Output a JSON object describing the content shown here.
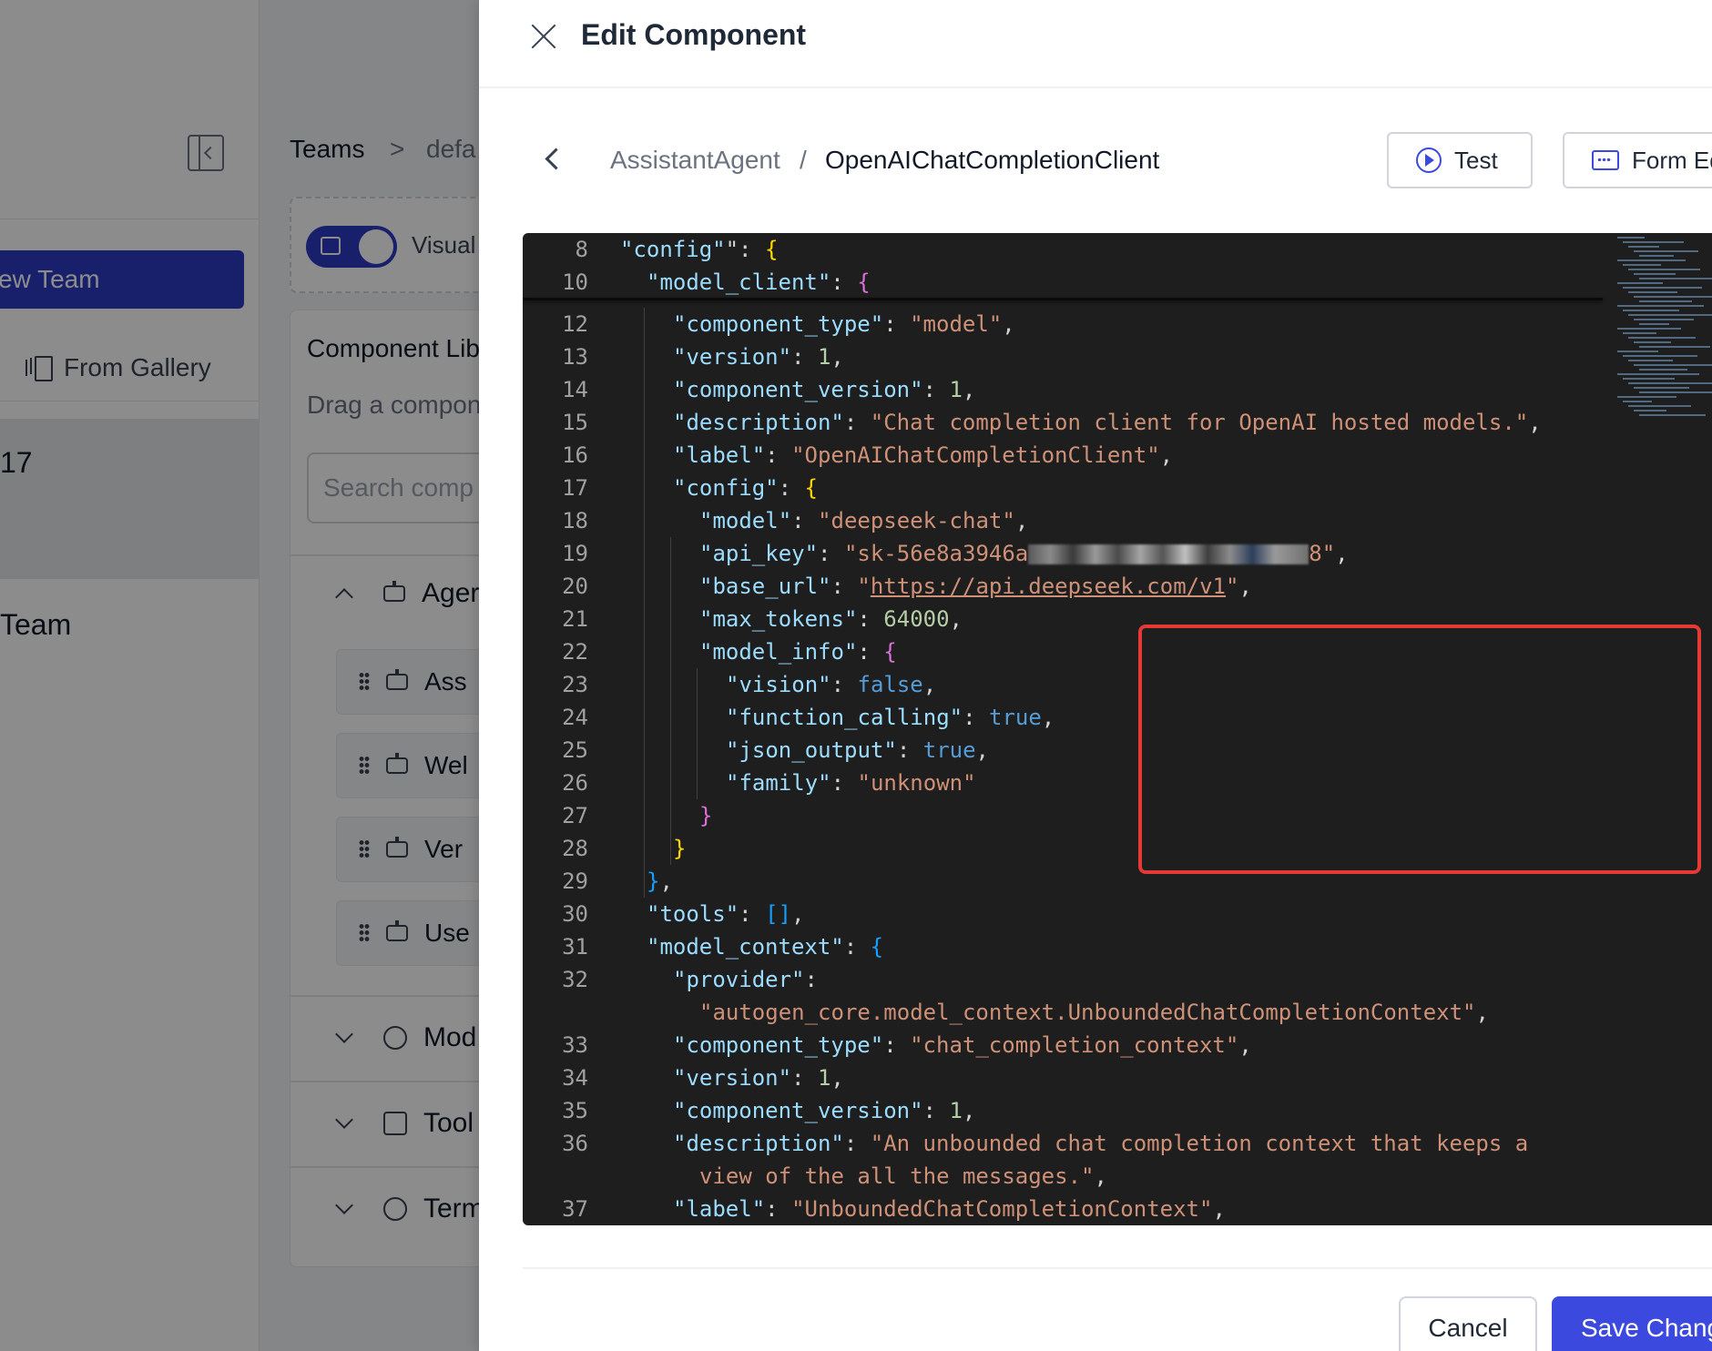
{
  "background": {
    "new_team_label": "ew Team",
    "from_gallery_label": "From Gallery",
    "team_card_number": "17",
    "team_name": "Team",
    "breadcrumb_teams": "Teams",
    "breadcrumb_sep": ">",
    "breadcrumb_current": "defa",
    "toggle_label": "Visual",
    "library": {
      "title": "Component Lib",
      "subtitle": "Drag a compon",
      "search_placeholder": "Search comp",
      "sections": [
        {
          "label": "Ager"
        },
        {
          "label": "Mod"
        },
        {
          "label": "Tool"
        },
        {
          "label": "Term"
        }
      ],
      "agent_items": [
        {
          "label": "Ass"
        },
        {
          "label": "Wel"
        },
        {
          "label": "Ver"
        },
        {
          "label": "Use"
        }
      ]
    }
  },
  "drawer": {
    "title": "Edit Component",
    "breadcrumb_parent": "AssistantAgent",
    "breadcrumb_sep": "/",
    "breadcrumb_current": "OpenAIChatCompletionClient",
    "test_label": "Test",
    "form_editor_label": "Form Ed",
    "cancel_label": "Cancel",
    "save_label": "Save Chang"
  },
  "editor": {
    "lines": [
      {
        "n": "8",
        "indent": 1,
        "tokens": [
          [
            "k",
            "\"config\""
          ],
          [
            "",
            "\": "
          ],
          [
            "p1",
            "{"
          ]
        ]
      },
      {
        "n": "10",
        "indent": 2,
        "tokens": [
          [
            "k",
            "\"model_client\""
          ],
          [
            "",
            ": "
          ],
          [
            "p2",
            "{"
          ]
        ]
      },
      {
        "n": "12",
        "indent": 3,
        "tokens": [
          [
            "k",
            "\"component_type\""
          ],
          [
            "",
            ": "
          ],
          [
            "s",
            "\"model\""
          ],
          [
            "",
            ","
          ]
        ]
      },
      {
        "n": "13",
        "indent": 3,
        "tokens": [
          [
            "k",
            "\"version\""
          ],
          [
            "",
            ": "
          ],
          [
            "n",
            "1"
          ],
          [
            "",
            ","
          ]
        ]
      },
      {
        "n": "14",
        "indent": 3,
        "tokens": [
          [
            "k",
            "\"component_version\""
          ],
          [
            "",
            ": "
          ],
          [
            "n",
            "1"
          ],
          [
            "",
            ","
          ]
        ]
      },
      {
        "n": "15",
        "indent": 3,
        "tokens": [
          [
            "k",
            "\"description\""
          ],
          [
            "",
            ": "
          ],
          [
            "s",
            "\"Chat completion client for OpenAI hosted models.\""
          ],
          [
            "",
            ","
          ]
        ]
      },
      {
        "n": "16",
        "indent": 3,
        "tokens": [
          [
            "k",
            "\"label\""
          ],
          [
            "",
            ": "
          ],
          [
            "s",
            "\"OpenAIChatCompletionClient\""
          ],
          [
            "",
            ","
          ]
        ]
      },
      {
        "n": "17",
        "indent": 3,
        "tokens": [
          [
            "k",
            "\"config\""
          ],
          [
            "",
            ": "
          ],
          [
            "p1",
            "{"
          ]
        ]
      },
      {
        "n": "18",
        "indent": 4,
        "tokens": [
          [
            "k",
            "\"model\""
          ],
          [
            "",
            ": "
          ],
          [
            "s",
            "\"deepseek-chat\""
          ],
          [
            "",
            ","
          ]
        ]
      },
      {
        "n": "19",
        "indent": 4,
        "tokens": [
          [
            "k",
            "\"api_key\""
          ],
          [
            "",
            ": "
          ],
          [
            "s",
            "\"sk-56e8a3946a"
          ],
          [
            "redact",
            ""
          ],
          [
            "s",
            "8\""
          ],
          [
            "",
            ","
          ]
        ]
      },
      {
        "n": "20",
        "indent": 4,
        "tokens": [
          [
            "k",
            "\"base_url\""
          ],
          [
            "",
            ": "
          ],
          [
            "s",
            "\""
          ],
          [
            "s url",
            "https://api.deepseek.com/v1"
          ],
          [
            "s",
            "\""
          ],
          [
            "",
            ","
          ]
        ]
      },
      {
        "n": "21",
        "indent": 4,
        "tokens": [
          [
            "k",
            "\"max_tokens\""
          ],
          [
            "",
            ": "
          ],
          [
            "n",
            "64000"
          ],
          [
            "",
            ","
          ]
        ]
      },
      {
        "n": "22",
        "indent": 4,
        "tokens": [
          [
            "k",
            "\"model_info\""
          ],
          [
            "",
            ": "
          ],
          [
            "p2",
            "{"
          ]
        ]
      },
      {
        "n": "23",
        "indent": 5,
        "tokens": [
          [
            "k",
            "\"vision\""
          ],
          [
            "",
            ": "
          ],
          [
            "b",
            "false"
          ],
          [
            "",
            ","
          ]
        ]
      },
      {
        "n": "24",
        "indent": 5,
        "tokens": [
          [
            "k",
            "\"function_calling\""
          ],
          [
            "",
            ": "
          ],
          [
            "b",
            "true"
          ],
          [
            "",
            ","
          ]
        ]
      },
      {
        "n": "25",
        "indent": 5,
        "tokens": [
          [
            "k",
            "\"json_output\""
          ],
          [
            "",
            ": "
          ],
          [
            "b",
            "true"
          ],
          [
            "",
            ","
          ]
        ]
      },
      {
        "n": "26",
        "indent": 5,
        "tokens": [
          [
            "k",
            "\"family\""
          ],
          [
            "",
            ": "
          ],
          [
            "s",
            "\"unknown\""
          ]
        ]
      },
      {
        "n": "27",
        "indent": 4,
        "tokens": [
          [
            "p2",
            "}"
          ]
        ]
      },
      {
        "n": "28",
        "indent": 3,
        "tokens": [
          [
            "p1",
            "}"
          ]
        ]
      },
      {
        "n": "29",
        "indent": 2,
        "tokens": [
          [
            "p3",
            "}"
          ],
          [
            "",
            ","
          ]
        ]
      },
      {
        "n": "30",
        "indent": 2,
        "tokens": [
          [
            "k",
            "\"tools\""
          ],
          [
            "",
            ": "
          ],
          [
            "p3",
            "[]"
          ],
          [
            "",
            ","
          ]
        ]
      },
      {
        "n": "31",
        "indent": 2,
        "tokens": [
          [
            "k",
            "\"model_context\""
          ],
          [
            "",
            ": "
          ],
          [
            "p3",
            "{"
          ]
        ]
      },
      {
        "n": "32",
        "indent": 3,
        "tokens": [
          [
            "k",
            "\"provider\""
          ],
          [
            "",
            ":"
          ]
        ]
      },
      {
        "n": "",
        "indent": 4,
        "tokens": [
          [
            "s",
            "\"autogen_core.model_context.UnboundedChatCompletionContext\""
          ],
          [
            "",
            ","
          ]
        ]
      },
      {
        "n": "33",
        "indent": 3,
        "tokens": [
          [
            "k",
            "\"component_type\""
          ],
          [
            "",
            ": "
          ],
          [
            "s",
            "\"chat_completion_context\""
          ],
          [
            "",
            ","
          ]
        ]
      },
      {
        "n": "34",
        "indent": 3,
        "tokens": [
          [
            "k",
            "\"version\""
          ],
          [
            "",
            ": "
          ],
          [
            "n",
            "1"
          ],
          [
            "",
            ","
          ]
        ]
      },
      {
        "n": "35",
        "indent": 3,
        "tokens": [
          [
            "k",
            "\"component_version\""
          ],
          [
            "",
            ": "
          ],
          [
            "n",
            "1"
          ],
          [
            "",
            ","
          ]
        ]
      },
      {
        "n": "36",
        "indent": 3,
        "tokens": [
          [
            "k",
            "\"description\""
          ],
          [
            "",
            ": "
          ],
          [
            "s",
            "\"An unbounded chat completion context that keeps a"
          ]
        ]
      },
      {
        "n": "",
        "indent": 4,
        "tokens": [
          [
            "s",
            "view of the all the messages.\""
          ],
          [
            "",
            ","
          ]
        ]
      },
      {
        "n": "37",
        "indent": 3,
        "tokens": [
          [
            "k",
            "\"label\""
          ],
          [
            "",
            ": "
          ],
          [
            "s",
            "\"UnboundedChatCompletionContext\""
          ],
          [
            "",
            ","
          ]
        ]
      }
    ]
  },
  "colors": {
    "accent": "#3b49df",
    "highlight_border": "#e53935",
    "editor_bg": "#1e1e1e"
  }
}
